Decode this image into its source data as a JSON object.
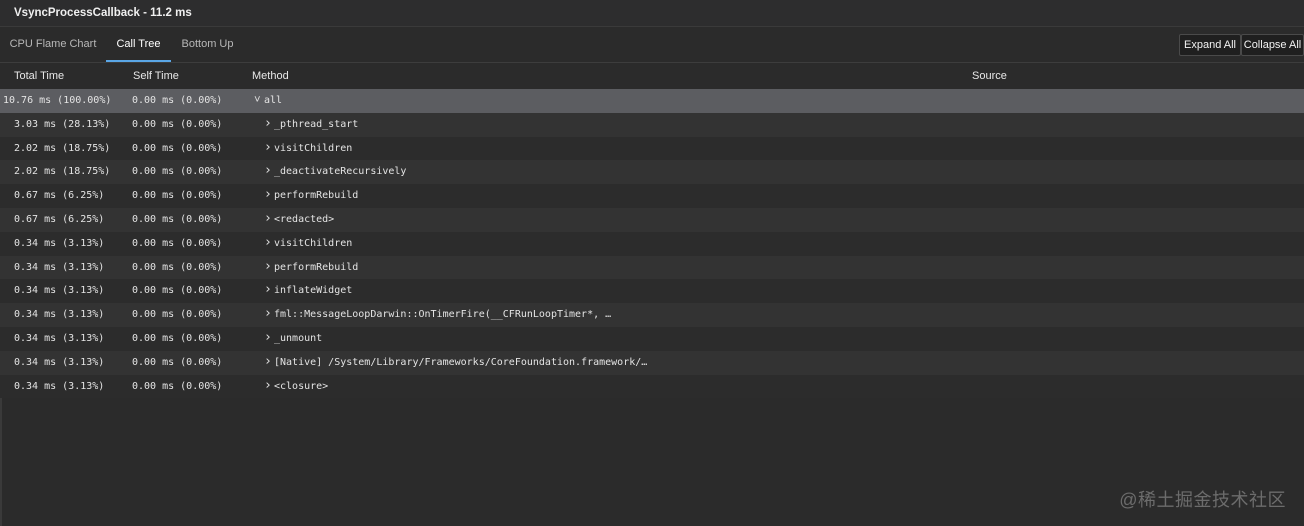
{
  "title": "VsyncProcessCallback - 11.2 ms",
  "tabs": [
    {
      "label": "CPU Flame Chart",
      "active": false
    },
    {
      "label": "Call Tree",
      "active": true
    },
    {
      "label": "Bottom Up",
      "active": false
    }
  ],
  "actions": {
    "expand_all": "Expand All",
    "collapse_all": "Collapse All"
  },
  "columns": {
    "total_time": "Total Time",
    "self_time": "Self Time",
    "method": "Method",
    "source": "Source"
  },
  "rows": [
    {
      "total": "10.76 ms (100.00%)",
      "self": "0.00 ms (0.00%)",
      "method": "all",
      "depth": 0,
      "expanded": true,
      "selected": true
    },
    {
      "total": "3.03 ms (28.13%)",
      "self": "0.00 ms (0.00%)",
      "method": "_pthread_start",
      "depth": 1,
      "expanded": false
    },
    {
      "total": "2.02 ms (18.75%)",
      "self": "0.00 ms (0.00%)",
      "method": "visitChildren",
      "depth": 1,
      "expanded": false
    },
    {
      "total": "2.02 ms (18.75%)",
      "self": "0.00 ms (0.00%)",
      "method": "_deactivateRecursively",
      "depth": 1,
      "expanded": false
    },
    {
      "total": "0.67 ms (6.25%)",
      "self": "0.00 ms (0.00%)",
      "method": "performRebuild",
      "depth": 1,
      "expanded": false
    },
    {
      "total": "0.67 ms (6.25%)",
      "self": "0.00 ms (0.00%)",
      "method": "<redacted>",
      "depth": 1,
      "expanded": false
    },
    {
      "total": "0.34 ms (3.13%)",
      "self": "0.00 ms (0.00%)",
      "method": "visitChildren",
      "depth": 1,
      "expanded": false
    },
    {
      "total": "0.34 ms (3.13%)",
      "self": "0.00 ms (0.00%)",
      "method": "performRebuild",
      "depth": 1,
      "expanded": false
    },
    {
      "total": "0.34 ms (3.13%)",
      "self": "0.00 ms (0.00%)",
      "method": "inflateWidget",
      "depth": 1,
      "expanded": false
    },
    {
      "total": "0.34 ms (3.13%)",
      "self": "0.00 ms (0.00%)",
      "method": "fml::MessageLoopDarwin::OnTimerFire(__CFRunLoopTimer*, …",
      "depth": 1,
      "expanded": false
    },
    {
      "total": "0.34 ms (3.13%)",
      "self": "0.00 ms (0.00%)",
      "method": "_unmount",
      "depth": 1,
      "expanded": false
    },
    {
      "total": "0.34 ms (3.13%)",
      "self": "0.00 ms (0.00%)",
      "method": "[Native] /System/Library/Frameworks/CoreFoundation.framework/…",
      "depth": 1,
      "expanded": false
    },
    {
      "total": "0.34 ms (3.13%)",
      "self": "0.00 ms (0.00%)",
      "method": "<closure>",
      "depth": 1,
      "expanded": false
    }
  ],
  "watermark": "@稀土掘金技术社区"
}
